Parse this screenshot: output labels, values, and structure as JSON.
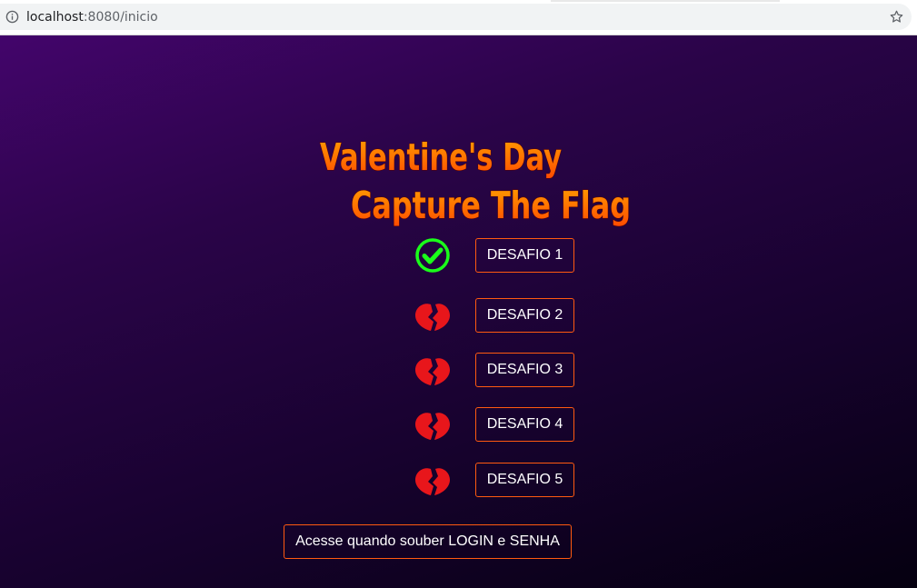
{
  "browser": {
    "url_host": "localhost",
    "url_path": ":8080/inicio"
  },
  "title": {
    "line1": "Valentine's Day",
    "line2": "Capture The Flag",
    "color": "#ff6a00"
  },
  "challenges": [
    {
      "label": "DESAFIO 1",
      "status": "completed",
      "icon": "check-circle-icon"
    },
    {
      "label": "DESAFIO 2",
      "status": "locked",
      "icon": "broken-heart-icon"
    },
    {
      "label": "DESAFIO 3",
      "status": "locked",
      "icon": "broken-heart-icon"
    },
    {
      "label": "DESAFIO 4",
      "status": "locked",
      "icon": "broken-heart-icon"
    },
    {
      "label": "DESAFIO 5",
      "status": "locked",
      "icon": "broken-heart-icon"
    }
  ],
  "login_button_label": "Acesse quando souber LOGIN e SENHA",
  "colors": {
    "accent": "#ff5a10",
    "completed": "#1aff1a",
    "locked": "#e8161b"
  }
}
